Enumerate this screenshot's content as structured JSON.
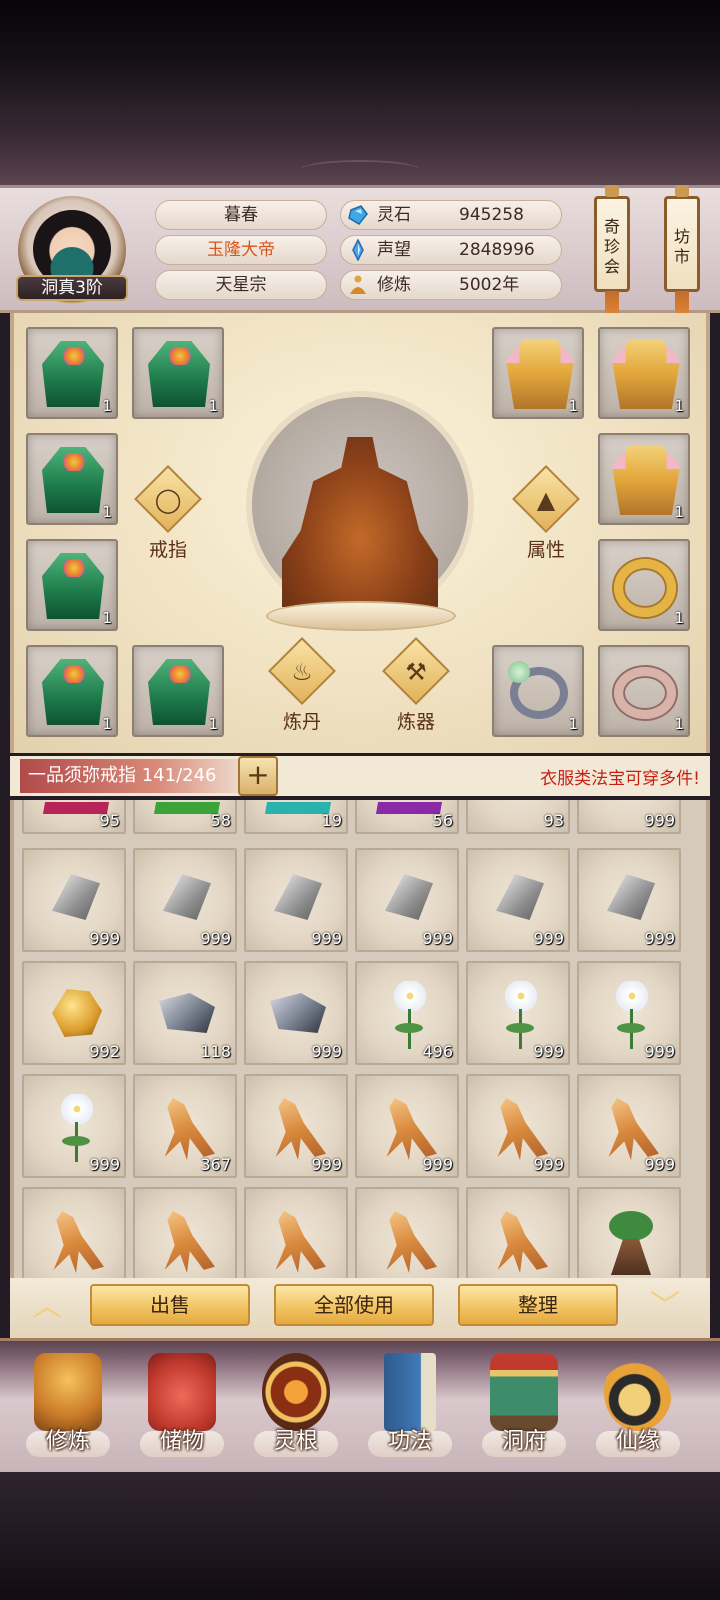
{
  "header": {
    "rank": "洞真3阶",
    "player_name": "暮春",
    "title": "玉隆大帝",
    "sect": "天星宗",
    "stats": [
      {
        "icon": "spirit-stone-icon",
        "label": "灵石",
        "value": "945258"
      },
      {
        "icon": "reputation-crystal-icon",
        "label": "声望",
        "value": "2848996"
      },
      {
        "icon": "cultivation-icon",
        "label": "修炼",
        "value": "5002年"
      }
    ],
    "banners": [
      {
        "label": "奇珍会"
      },
      {
        "label": "坊市"
      }
    ]
  },
  "equipment": {
    "slot_count": "1",
    "buttons": {
      "ring": "戒指",
      "attributes": "属性",
      "alchemy": "炼丹",
      "forging": "炼器"
    }
  },
  "storage": {
    "ring_name": "一品须弥戒指 141/246",
    "plus": "+",
    "notice": "衣服类法宝可穿多件!"
  },
  "inventory": {
    "rows": [
      [
        "95",
        "58",
        "19",
        "56",
        "93",
        "999"
      ],
      [
        "999",
        "999",
        "999",
        "999",
        "999",
        "999"
      ],
      [
        "992",
        "118",
        "999",
        "496",
        "999",
        "999"
      ],
      [
        "999",
        "367",
        "999",
        "999",
        "999",
        "999"
      ],
      [
        "",
        "",
        "",
        "",
        "",
        ""
      ]
    ]
  },
  "actions": {
    "up_arrow": "︿",
    "down_arrow": "﹀",
    "sell": "出售",
    "use_all": "全部使用",
    "sort": "整理"
  },
  "nav": [
    {
      "label": "修炼",
      "icon": "cultivate-icon"
    },
    {
      "label": "储物",
      "icon": "storage-bag-icon"
    },
    {
      "label": "灵根",
      "icon": "spirit-root-icon"
    },
    {
      "label": "功法",
      "icon": "technique-book-icon"
    },
    {
      "label": "洞府",
      "icon": "cave-abode-icon"
    },
    {
      "label": "仙缘",
      "icon": "immortal-fate-icon"
    }
  ],
  "colors": {
    "title_accent": "#d8561c",
    "notice_red": "#c92016",
    "button_gold": "#f2c564"
  }
}
